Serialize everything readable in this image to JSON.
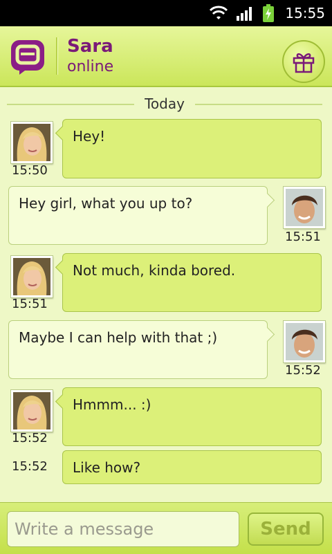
{
  "status_bar": {
    "time": "15:55"
  },
  "header": {
    "name": "Sara",
    "status": "online"
  },
  "chat": {
    "day_label": "Today",
    "messages": [
      {
        "side": "in",
        "text": "Hey!",
        "time": "15:50",
        "avatar": "sara"
      },
      {
        "side": "out",
        "text": "Hey girl, what you up to?",
        "time": "15:51",
        "avatar": "me"
      },
      {
        "side": "in",
        "text": "Not much, kinda bored.",
        "time": "15:51",
        "avatar": "sara"
      },
      {
        "side": "out",
        "text": "Maybe I can help with that ;)",
        "time": "15:52",
        "avatar": "me"
      },
      {
        "side": "in",
        "text": "Hmmm... :)",
        "time": "15:52",
        "avatar": "sara"
      },
      {
        "side": "in",
        "text": "Like how?",
        "time": "15:52",
        "avatar": "none"
      }
    ]
  },
  "compose": {
    "placeholder": "Write a message",
    "send_label": "Send"
  },
  "colors": {
    "accent_purple": "#7a1a78",
    "bubble_in": "#dcf079",
    "bubble_out": "#f6fdd7"
  }
}
